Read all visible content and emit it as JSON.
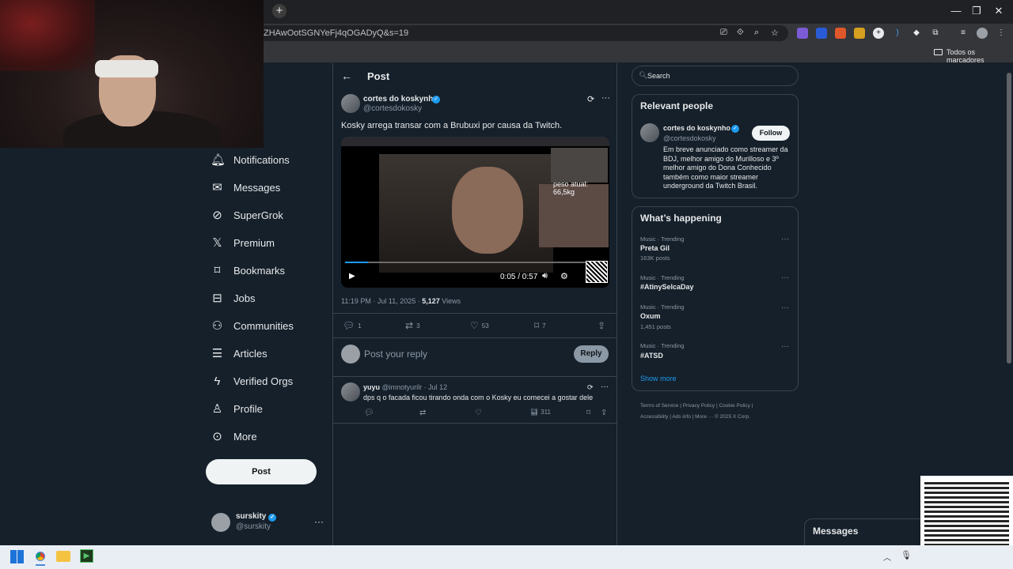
{
  "browser": {
    "url": "ZHAwOotSGNYeFj4qOGADyQ&s=19",
    "bookmarks_label": "Todos os marcadores"
  },
  "sidebar": {
    "items": [
      {
        "label": "Notifications",
        "icon": "bell-icon"
      },
      {
        "label": "Messages",
        "icon": "envelope-icon"
      },
      {
        "label": "SuperGrok",
        "icon": "grok-icon"
      },
      {
        "label": "Premium",
        "icon": "x-logo-icon"
      },
      {
        "label": "Bookmarks",
        "icon": "bookmark-icon"
      },
      {
        "label": "Jobs",
        "icon": "briefcase-icon"
      },
      {
        "label": "Communities",
        "icon": "people-icon"
      },
      {
        "label": "Articles",
        "icon": "article-icon"
      },
      {
        "label": "Verified Orgs",
        "icon": "lightning-icon"
      },
      {
        "label": "Profile",
        "icon": "person-icon"
      },
      {
        "label": "More",
        "icon": "more-circle-icon"
      }
    ],
    "post_button": "Post",
    "account": {
      "name": "surskity",
      "handle": "@surskity"
    }
  },
  "header": {
    "title": "Post"
  },
  "tweet": {
    "author_name": "cortes do koskynho",
    "author_handle": "@cortesdokosky",
    "text": "Kosky arrega transar com a Brubuxi por causa da Twitch.",
    "video": {
      "overlay_text": "peso atual: 66,5kg",
      "time": "0:05 / 0:57",
      "progress": 0.088
    },
    "timestamp": "11:19 PM · Jul 11, 2025 · ",
    "views_count": "5,127",
    "views_label": " Views",
    "actions": {
      "replies": "1",
      "reposts": "3",
      "likes": "53",
      "bookmarks": "7"
    },
    "reply_placeholder": "Post your reply",
    "reply_button": "Reply"
  },
  "reply": {
    "name": "yuyu",
    "handle": " @imnotyurilr · Jul 12",
    "text": "dps q o facada ficou tirando onda com o Kosky eu comecei a gostar dele",
    "views": "311"
  },
  "right": {
    "search_placeholder": "Search",
    "relevant_title": "Relevant people",
    "person": {
      "name": "cortes do koskynho",
      "handle": "@cortesdokosky",
      "follow": "Follow",
      "bio": "Em breve anunciado como streamer da BDJ, melhor amigo do Murilloso e 3º melhor amigo do Dona Conhecido também como maior streamer underground da Twitch Brasil."
    },
    "happening_title": "What’s happening",
    "trends": [
      {
        "category": "Music · Trending",
        "name": "Preta Gil",
        "count": "163K posts"
      },
      {
        "category": "Music · Trending",
        "name": "#AtinySelcaDay",
        "count": ""
      },
      {
        "category": "Music · Trending",
        "name": "Oxum",
        "count": "1,451 posts"
      },
      {
        "category": "Music · Trending",
        "name": "#ATSD",
        "count": ""
      }
    ],
    "show_more": "Show more",
    "footer_line1": "Terms of Service  |  Privacy Policy  |  Cookie Policy  |",
    "footer_line2": "Accessibility  |  Ads info  |  More ···  © 2025 X Corp."
  },
  "drawer": {
    "title": "Messages"
  },
  "colors": {
    "accent": "#1d9bf0",
    "background": "#15202b",
    "border": "#38444d",
    "muted": "#8b98a5"
  }
}
